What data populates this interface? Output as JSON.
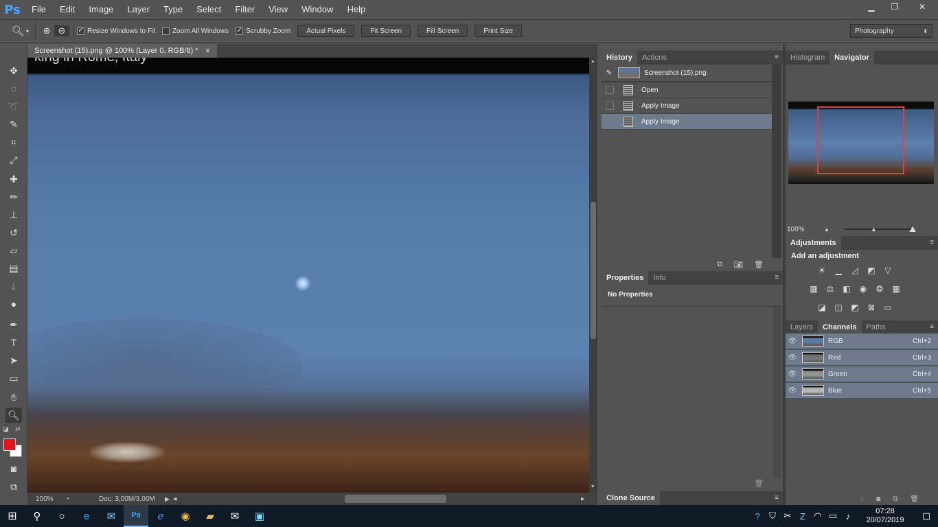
{
  "app": {
    "logo": "Ps"
  },
  "menu": [
    "File",
    "Edit",
    "Image",
    "Layer",
    "Type",
    "Select",
    "Filter",
    "View",
    "Window",
    "Help"
  ],
  "window_controls": {
    "minimize": "▁",
    "restore": "❐",
    "close": "✕"
  },
  "options": {
    "resize_windows_label": "Resize Windows to Fit",
    "zoom_all_label": "Zoom All Windows",
    "scrubby_label": "Scrubby Zoom",
    "actual_pixels": "Actual Pixels",
    "fit_screen": "Fit Screen",
    "fill_screen": "Fill Screen",
    "print_size": "Print Size",
    "workspace": "Photography"
  },
  "document": {
    "tab_title": "Screenshot (15).png @ 100% (Layer 0, RGB/8) *",
    "caption": "king in Rome, Italy",
    "zoom": "100%",
    "doc_size": "Doc: 3,00M/3,00M"
  },
  "history_panel": {
    "tabs": [
      "History",
      "Actions"
    ],
    "snapshot": "Screenshot (15).png",
    "steps": [
      "Open",
      "Apply Image",
      "Apply Image"
    ]
  },
  "properties_panel": {
    "tabs": [
      "Properties",
      "Info"
    ],
    "message": "No Properties"
  },
  "clone_source": "Clone Source",
  "navigator_panel": {
    "tabs": [
      "Histogram",
      "Navigator"
    ],
    "zoom": "100%"
  },
  "adjustments_panel": {
    "title": "Adjustments",
    "subtitle": "Add an adjustment"
  },
  "channels_panel": {
    "tabs": [
      "Layers",
      "Channels",
      "Paths"
    ],
    "channels": [
      {
        "name": "RGB",
        "shortcut": "Ctrl+2"
      },
      {
        "name": "Red",
        "shortcut": "Ctrl+3"
      },
      {
        "name": "Green",
        "shortcut": "Ctrl+4"
      },
      {
        "name": "Blue",
        "shortcut": "Ctrl+5"
      }
    ]
  },
  "taskbar": {
    "time": "07:28",
    "date": "20/07/2019"
  },
  "colors": {
    "foreground": "#e8141b",
    "background": "#ffffff",
    "selection": "#6c7a8c",
    "nav_rect": "#e04040"
  }
}
